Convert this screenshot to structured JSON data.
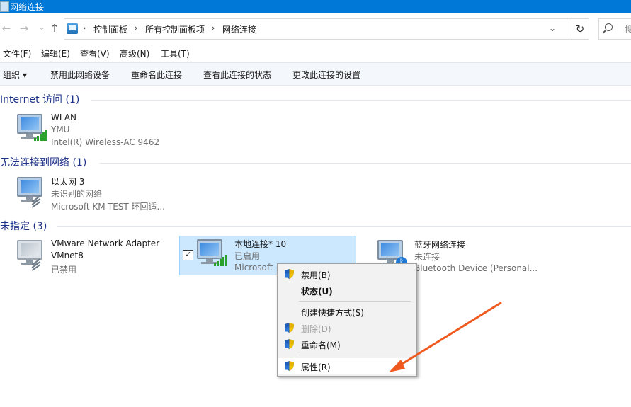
{
  "window": {
    "title": "网络连接"
  },
  "address": {
    "breadcrumbs": [
      "控制面板",
      "所有控制面板项",
      "网络连接"
    ],
    "search_placeholder": "搜"
  },
  "menubar": [
    "文件(F)",
    "编辑(E)",
    "查看(V)",
    "高级(N)",
    "工具(T)"
  ],
  "commands": {
    "organize": "组织",
    "disable": "禁用此网络设备",
    "rename": "重命名此连接",
    "status": "查看此连接的状态",
    "change": "更改此连接的设置"
  },
  "groups": [
    {
      "title": "Internet 访问 (1)",
      "items": [
        {
          "name": "WLAN",
          "line2": "YMU",
          "line3": "Intel(R) Wireless-AC 9462",
          "icon": "wifi-signal-icon"
        }
      ]
    },
    {
      "title": "无法连接到网络 (1)",
      "items": [
        {
          "name": "以太网 3",
          "line2": "未识别的网络",
          "line3": "Microsoft KM-TEST 环回适...",
          "icon": "ethernet-cable-icon"
        }
      ]
    },
    {
      "title": "未指定 (3)",
      "items": [
        {
          "name": "VMware Network Adapter",
          "name2": "VMnet8",
          "line3": "已禁用",
          "icon": "ethernet-cable-icon"
        },
        {
          "name": "本地连接* 10",
          "line2": "已启用",
          "line3": "Microsoft",
          "icon": "wifi-signal-icon",
          "selected": true
        },
        {
          "name": "蓝牙网络连接",
          "line2": "未连接",
          "line3": "Bluetooth Device (Personal...",
          "icon": "bluetooth-icon"
        }
      ]
    }
  ],
  "context_menu": [
    {
      "label": "禁用(B)",
      "shield": true
    },
    {
      "label": "状态(U)",
      "bold": true
    },
    {
      "label": "创建快捷方式(S)"
    },
    {
      "label": "删除(D)",
      "shield": true,
      "disabled": true
    },
    {
      "label": "重命名(M)",
      "shield": true
    },
    {
      "label": "属性(R)",
      "shield": true,
      "hover": true
    }
  ],
  "colors": {
    "titlebar": "#0078d7",
    "group_header": "#1e3287",
    "selection": "#cce8ff",
    "arrow": "#f05a1e"
  }
}
